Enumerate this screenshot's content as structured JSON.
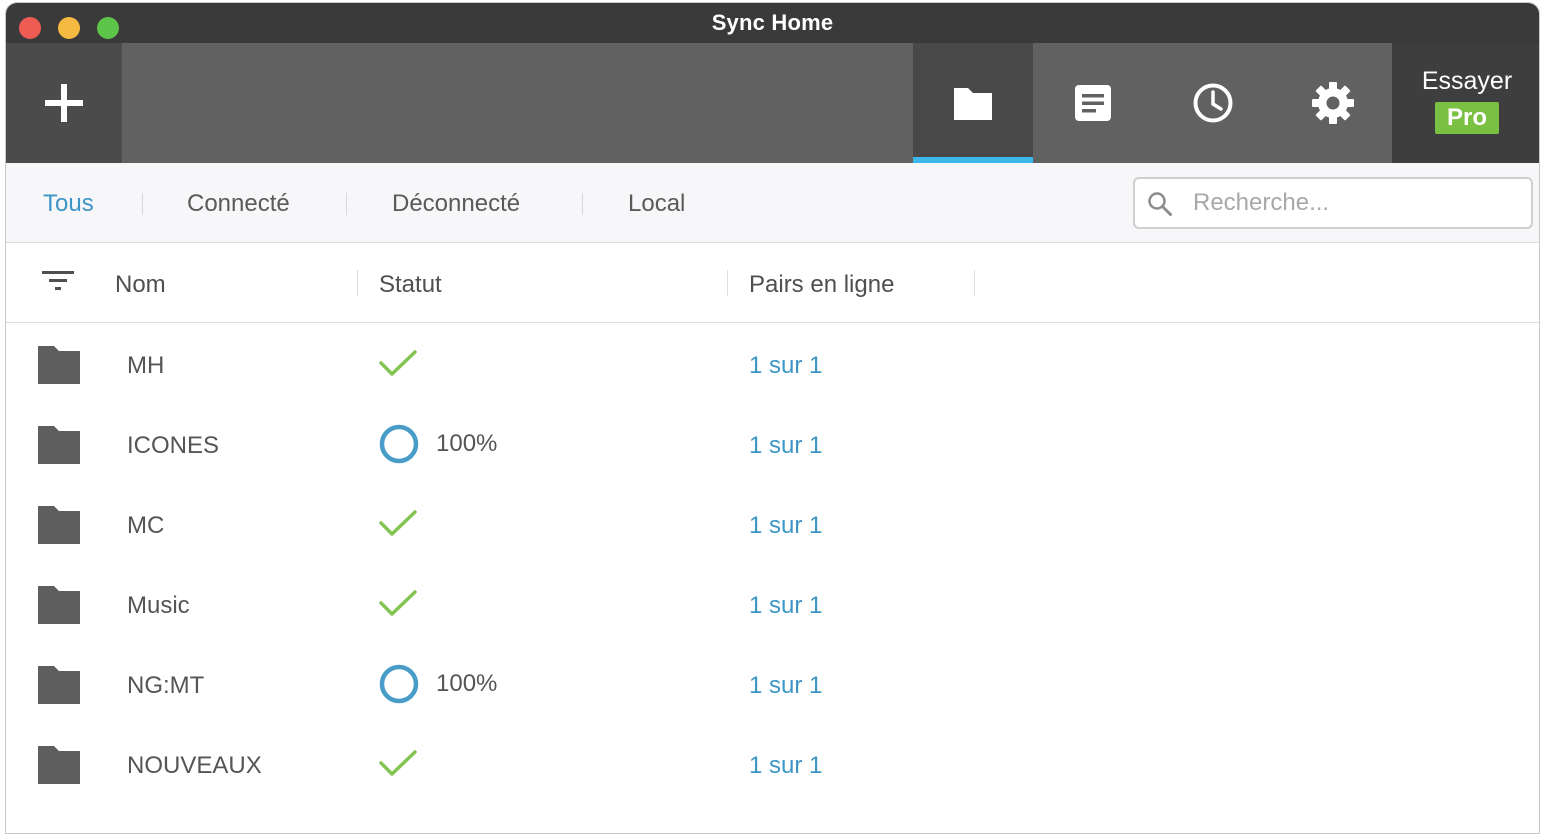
{
  "window": {
    "title": "Sync Home"
  },
  "toolbar": {
    "add_icon": "plus-icon",
    "tools": [
      {
        "icon": "folder-icon",
        "active": true
      },
      {
        "icon": "document-icon",
        "active": false
      },
      {
        "icon": "clock-icon",
        "active": false
      },
      {
        "icon": "gear-icon",
        "active": false
      }
    ],
    "pro": {
      "label": "Essayer",
      "badge": "Pro"
    },
    "accent_color": "#3db6ec",
    "badge_color": "#7ac143"
  },
  "filters": {
    "tabs": [
      "Tous",
      "Connecté",
      "Déconnecté",
      "Local"
    ],
    "active": "Tous",
    "search_placeholder": "Recherche..."
  },
  "table": {
    "columns": [
      "Nom",
      "Statut",
      "Pairs en ligne"
    ],
    "rows": [
      {
        "name": "MH",
        "status": "ok",
        "status_text": "",
        "peers": "1 sur 1"
      },
      {
        "name": "ICONES",
        "status": "syncing",
        "status_text": "100%",
        "peers": "1 sur 1"
      },
      {
        "name": "MC",
        "status": "ok",
        "status_text": "",
        "peers": "1 sur 1"
      },
      {
        "name": "Music",
        "status": "ok",
        "status_text": "",
        "peers": "1 sur 1"
      },
      {
        "name": "NG:MT",
        "status": "syncing",
        "status_text": "100%",
        "peers": "1 sur 1"
      },
      {
        "name": "NOUVEAUX",
        "status": "ok",
        "status_text": "",
        "peers": "1 sur 1"
      }
    ]
  }
}
